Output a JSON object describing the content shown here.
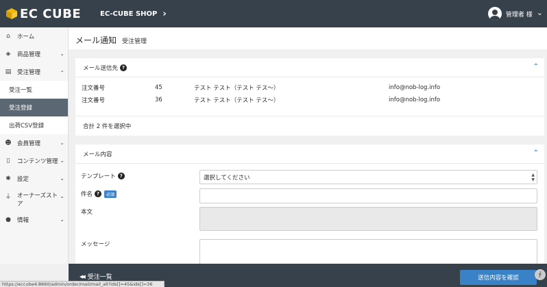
{
  "header": {
    "logo_text": "EC CUBE",
    "shop_name": "EC-CUBE SHOP",
    "shop_chevron": "›",
    "user_label": "管理者 様",
    "user_chevron": "⌄"
  },
  "sidebar": {
    "items": [
      {
        "label": "ホーム",
        "icon": "home-icon",
        "glyph": "⌂"
      },
      {
        "label": "商品管理",
        "icon": "cube-icon",
        "glyph": "◈",
        "chevron": "⌄"
      },
      {
        "label": "受注管理",
        "icon": "cart-icon",
        "glyph": "▤",
        "chevron": "⌃"
      }
    ],
    "sub_items": [
      {
        "label": "受注一覧"
      },
      {
        "label": "受注登録"
      },
      {
        "label": "出荷CSV登録"
      }
    ],
    "items2": [
      {
        "label": "会員管理",
        "icon": "users-icon",
        "glyph": "☻",
        "chevron": "⌄"
      },
      {
        "label": "コンテンツ管理",
        "icon": "file-icon",
        "glyph": "▯",
        "chevron": "⌄"
      },
      {
        "label": "設定",
        "icon": "gear-icon",
        "glyph": "✱",
        "chevron": "⌄"
      },
      {
        "label": "オーナーズストア",
        "icon": "plug-icon",
        "glyph": "⏚",
        "chevron": "⌄"
      },
      {
        "label": "情報",
        "icon": "info-icon",
        "glyph": "●",
        "chevron": "⌄"
      }
    ]
  },
  "page": {
    "title": "メール通知",
    "subtitle": "受注管理"
  },
  "recipients": {
    "heading": "メール送信先",
    "collapse": "⌃",
    "rows": [
      {
        "label": "注文番号",
        "number": "45",
        "name": "テスト テスト（テスト テス～）",
        "email": "info@nob-log.info"
      },
      {
        "label": "注文番号",
        "number": "36",
        "name": "テスト テスト（テスト テス～）",
        "email": "info@nob-log.info"
      }
    ],
    "total": "合計 2 件を選択中"
  },
  "mail": {
    "heading": "メール内容",
    "collapse": "⌃",
    "template_label": "テンプレート",
    "template_value": "選択してください",
    "subject_label": "件名",
    "required_badge": "必須",
    "body_label": "本文",
    "message_label": "メッセージ"
  },
  "footer": {
    "back_label": "受注一覧",
    "back_icon": "◀◀",
    "confirm_label": "送信内容を確認",
    "corner_icon": "∮"
  },
  "statusbar": {
    "url": "https://eccube4:8660/admin/order/mail/mail_all?ids[]=45&ids[]=36"
  }
}
